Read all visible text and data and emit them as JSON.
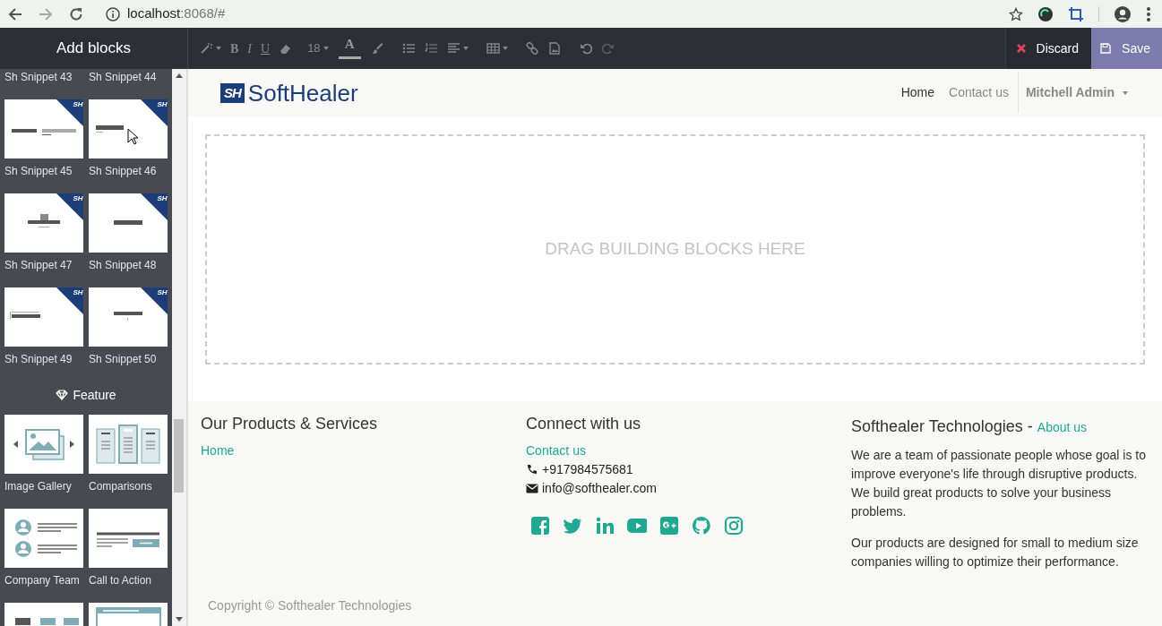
{
  "browser": {
    "url_host": "localhost",
    "url_rest": ":8068/#",
    "forward_disabled": true
  },
  "editor": {
    "panel_title": "Add blocks",
    "toolbar": [
      {
        "kind": "wand",
        "dropdown": true
      },
      {
        "kind": "bold",
        "text": "B",
        "dropdown": false
      },
      {
        "kind": "italic",
        "text": "I",
        "dropdown": false
      },
      {
        "kind": "underline",
        "text": "U",
        "dropdown": false
      },
      {
        "kind": "eraser",
        "dropdown": false
      },
      {
        "kind": "font-size",
        "text": "18",
        "dropdown": true
      },
      {
        "kind": "color",
        "text": "A",
        "dropdown": false
      },
      {
        "kind": "brush",
        "dropdown": false
      },
      {
        "kind": "ul",
        "dropdown": false
      },
      {
        "kind": "ol",
        "dropdown": false
      },
      {
        "kind": "align",
        "dropdown": true
      },
      {
        "kind": "table",
        "dropdown": true
      },
      {
        "kind": "link",
        "dropdown": false
      },
      {
        "kind": "image",
        "dropdown": false
      },
      {
        "kind": "undo",
        "dropdown": false
      },
      {
        "kind": "redo",
        "dropdown": false
      }
    ],
    "discard": "Discard",
    "save": "Save"
  },
  "sidebar": {
    "sections": [
      {
        "blocks": [
          {
            "label": "Sh Snippet 43"
          },
          {
            "label": "Sh Snippet 44"
          },
          {
            "label": "Sh Snippet 45",
            "kind": "two-bars",
            "badge": "SH"
          },
          {
            "label": "Sh Snippet 46",
            "kind": "bar-left",
            "badge": "SH"
          },
          {
            "label": "Sh Snippet 47",
            "kind": "bar-stand",
            "badge": "SH"
          },
          {
            "label": "Sh Snippet 48",
            "kind": "bar-center",
            "badge": "SH"
          },
          {
            "label": "Sh Snippet 49",
            "kind": "bar-edge",
            "badge": "SH"
          },
          {
            "label": "Sh Snippet 50",
            "kind": "bar-center-small",
            "badge": "SH"
          }
        ]
      },
      {
        "title": "Feature",
        "blocks": [
          {
            "label": "Image Gallery",
            "kind": "gallery"
          },
          {
            "label": "Comparisons",
            "kind": "comparisons"
          },
          {
            "label": "Company Team",
            "kind": "team"
          },
          {
            "label": "Call to Action",
            "kind": "cta"
          },
          {
            "kind": "columns"
          },
          {
            "kind": "window"
          }
        ]
      }
    ]
  },
  "navbar": {
    "logo_mark": "SH",
    "logo_text": "SoftHealer",
    "items": [
      {
        "label": "Home",
        "selected": true
      },
      {
        "label": "Contact us",
        "selected": false
      }
    ],
    "user": "Mitchell Admin"
  },
  "drop_zone": {
    "text": "DRAG BUILDING BLOCKS HERE"
  },
  "footer": {
    "columns": [
      {
        "title": "Our Products & Services",
        "links": [
          "Home"
        ]
      },
      {
        "title": "Connect with us",
        "links": [
          "Contact us"
        ],
        "contacts": [
          {
            "kind": "phone",
            "text": "+917984575681"
          },
          {
            "kind": "email",
            "text": "info@softhealer.com"
          }
        ],
        "social": [
          {
            "kind": "facebook"
          },
          {
            "kind": "twitter"
          },
          {
            "kind": "linkedin"
          },
          {
            "kind": "youtube"
          },
          {
            "kind": "google-plus"
          },
          {
            "kind": "github"
          },
          {
            "kind": "instagram"
          }
        ]
      },
      {
        "title": "Softhealer Technologies",
        "title_sep": "-",
        "title_link": "About us",
        "paragraphs": [
          "We are a team of passionate people whose goal is to improve everyone's life through disruptive products. We build great products to solve your business problems.",
          "Our products are designed for small to medium size companies willing to optimize their performance."
        ]
      }
    ],
    "copyright": "Copyright © Softhealer Technologies"
  }
}
